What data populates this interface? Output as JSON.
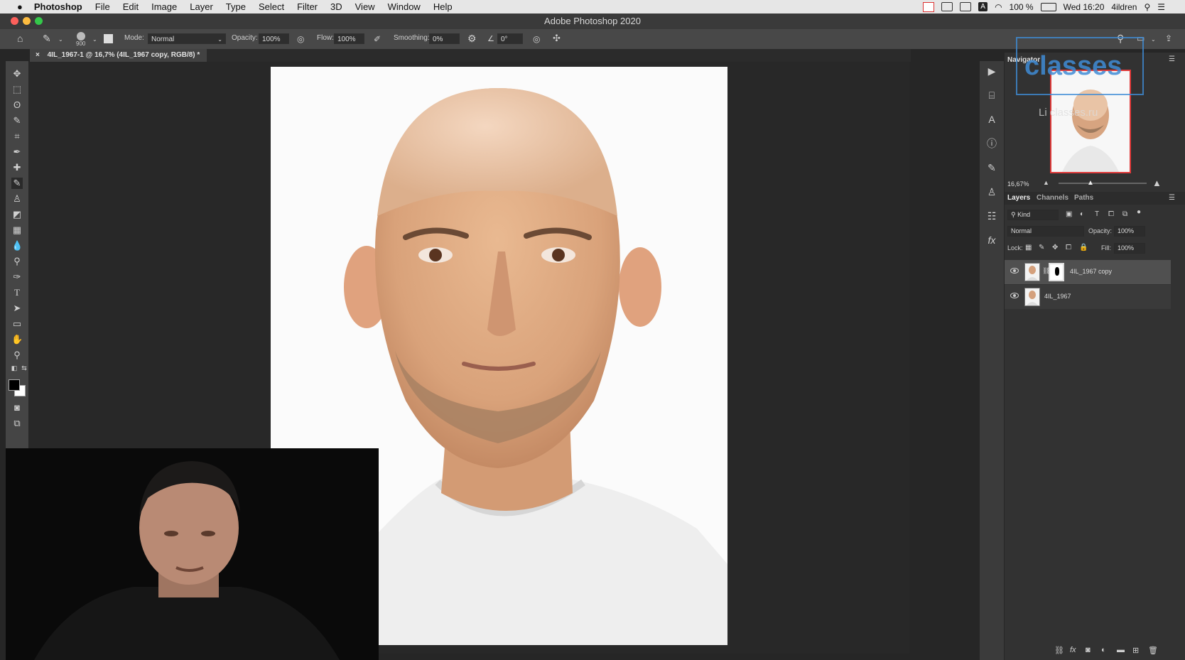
{
  "menubar": {
    "apple": "",
    "app_name": "Photoshop",
    "items": [
      "File",
      "Edit",
      "Image",
      "Layer",
      "Type",
      "Select",
      "Filter",
      "3D",
      "View",
      "Window",
      "Help"
    ],
    "battery": "100 %",
    "clock": "Wed 16:20",
    "user": "4ildren",
    "input_letter": "A"
  },
  "window": {
    "title": "Adobe Photoshop 2020"
  },
  "options": {
    "brush_size": "900",
    "mode_label": "Mode:",
    "mode_value": "Normal",
    "opacity_label": "Opacity:",
    "opacity_value": "100%",
    "flow_label": "Flow:",
    "flow_value": "100%",
    "smoothing_label": "Smoothing:",
    "smoothing_value": "0%",
    "angle_value": "0°"
  },
  "document": {
    "tab_title": "4IL_1967-1 @ 16,7% (4IL_1967 copy, RGB/8) *"
  },
  "navigator": {
    "title": "Navigator",
    "zoom": "16,67%",
    "watermark_big": "classes",
    "watermark_small": "Li  classes.ru"
  },
  "layers_panel": {
    "tabs": [
      "Layers",
      "Channels",
      "Paths"
    ],
    "filter_kind": "Kind",
    "blend_mode": "Normal",
    "opacity_label": "Opacity:",
    "opacity_value": "100%",
    "lock_label": "Lock:",
    "fill_label": "Fill:",
    "fill_value": "100%",
    "layers": [
      {
        "name": "4IL_1967 copy",
        "selected": true,
        "has_mask": true
      },
      {
        "name": "4IL_1967",
        "selected": false,
        "has_mask": false
      }
    ]
  },
  "colors": {
    "menubar_bg": "#e6e6e6",
    "ui_dark": "#323232",
    "canvas_bg": "#282828",
    "selected_row": "#505050",
    "nav_frame": "#e03a3a"
  }
}
